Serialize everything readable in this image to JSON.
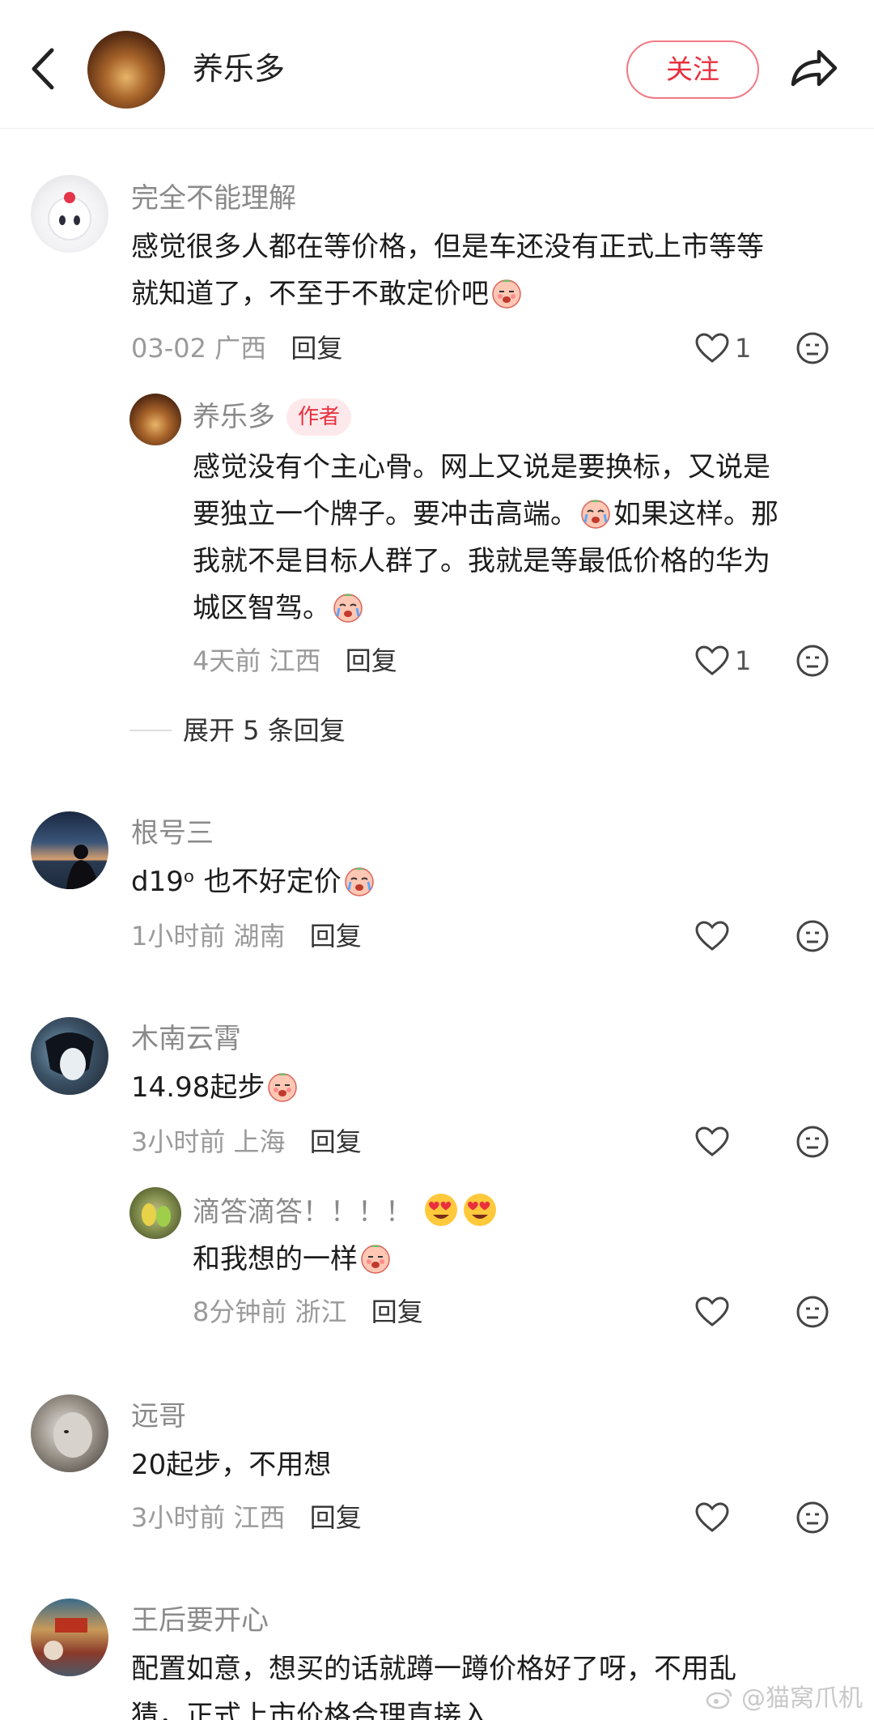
{
  "header": {
    "title": "养乐多",
    "follow_label": "关注"
  },
  "comments": [
    {
      "username": "完全不能理解",
      "text_1": "感觉很多人都在等价格，但是车还没有正式上市等等",
      "text_2": "就知道了，不至于不敢定价吧",
      "time": "03-02",
      "location": "广西",
      "reply_label": "回复",
      "likes": "1"
    },
    {
      "username": "养乐多",
      "badge": "作者",
      "text_1": "感觉没有个主心骨。网上又说是要换标，又说是",
      "text_2a": "要独立一个牌子。要冲击高端。",
      "text_2b": "如果这样。那",
      "text_3": "我就不是目标人群了。我就是等最低价格的华为",
      "text_4": "城区智驾。",
      "time": "4天前",
      "location": "江西",
      "reply_label": "回复",
      "likes": "1"
    },
    {
      "username": "根号三",
      "text_1": "d19ᵒ 也不好定价",
      "time": "1小时前",
      "location": "湖南",
      "reply_label": "回复"
    },
    {
      "username": "木南云霄",
      "text_1": "14.98起步",
      "time": "3小时前",
      "location": "上海",
      "reply_label": "回复"
    },
    {
      "username": "滴答滴答！！！！",
      "text_1": "和我想的一样",
      "time": "8分钟前",
      "location": "浙江",
      "reply_label": "回复"
    },
    {
      "username": "远哥",
      "text_1": "20起步，不用想",
      "time": "3小时前",
      "location": "江西",
      "reply_label": "回复"
    },
    {
      "username": "王后要开心",
      "text_1": "配置如意，想买的话就蹲一蹲价格好了呀，不用乱",
      "text_2": "猜，正式上市价格合理直接入"
    }
  ],
  "expand_label": "展开 5 条回复",
  "watermark": "@猫窝爪机",
  "colors": {
    "accent": "#e8303f",
    "badge_bg": "#fde9eb",
    "meta_gray": "#9a9a9a"
  },
  "icons": [
    "back-arrow-icon",
    "share-icon",
    "heart-icon",
    "dislike-face-icon",
    "cry-emoji-icon",
    "heart-eyes-emoji-icon",
    "weibo-icon"
  ]
}
